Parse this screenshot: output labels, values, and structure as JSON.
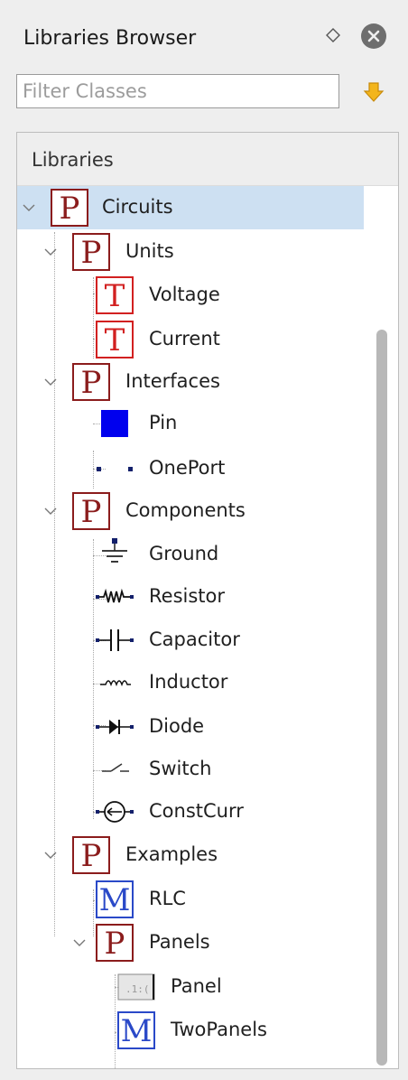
{
  "panel": {
    "title": "Libraries Browser",
    "float_icon": "diamond-icon",
    "close_icon": "close-icon"
  },
  "filter": {
    "placeholder": "Filter Classes",
    "value": "",
    "button_icon": "filter-arrow-icon"
  },
  "tree": {
    "header": "Libraries",
    "items": [
      {
        "label": "Circuits",
        "icon": "P",
        "expanded": true,
        "selected": true
      },
      {
        "label": "Units",
        "icon": "P",
        "expanded": true
      },
      {
        "label": "Voltage",
        "icon": "T"
      },
      {
        "label": "Current",
        "icon": "T"
      },
      {
        "label": "Interfaces",
        "icon": "P",
        "expanded": true
      },
      {
        "label": "Pin",
        "icon": "pin-icon"
      },
      {
        "label": "OnePort",
        "icon": "oneport-icon"
      },
      {
        "label": "Components",
        "icon": "P",
        "expanded": true
      },
      {
        "label": "Ground",
        "icon": "ground-icon"
      },
      {
        "label": "Resistor",
        "icon": "resistor-icon"
      },
      {
        "label": "Capacitor",
        "icon": "capacitor-icon"
      },
      {
        "label": "Inductor",
        "icon": "inductor-icon"
      },
      {
        "label": "Diode",
        "icon": "diode-icon"
      },
      {
        "label": "Switch",
        "icon": "switch-icon"
      },
      {
        "label": "ConstCurr",
        "icon": "current-source-icon"
      },
      {
        "label": "Examples",
        "icon": "P",
        "expanded": true
      },
      {
        "label": "RLC",
        "icon": "M"
      },
      {
        "label": "Panels",
        "icon": "P",
        "expanded": true
      },
      {
        "label": "Panel",
        "icon": "panel-icon"
      },
      {
        "label": "TwoPanels",
        "icon": "M"
      }
    ]
  },
  "colors": {
    "package": "#8b1c1c",
    "type": "#d22020",
    "model": "#2a49c8",
    "selection": "#cde0f2",
    "pin": "#0000ee"
  }
}
